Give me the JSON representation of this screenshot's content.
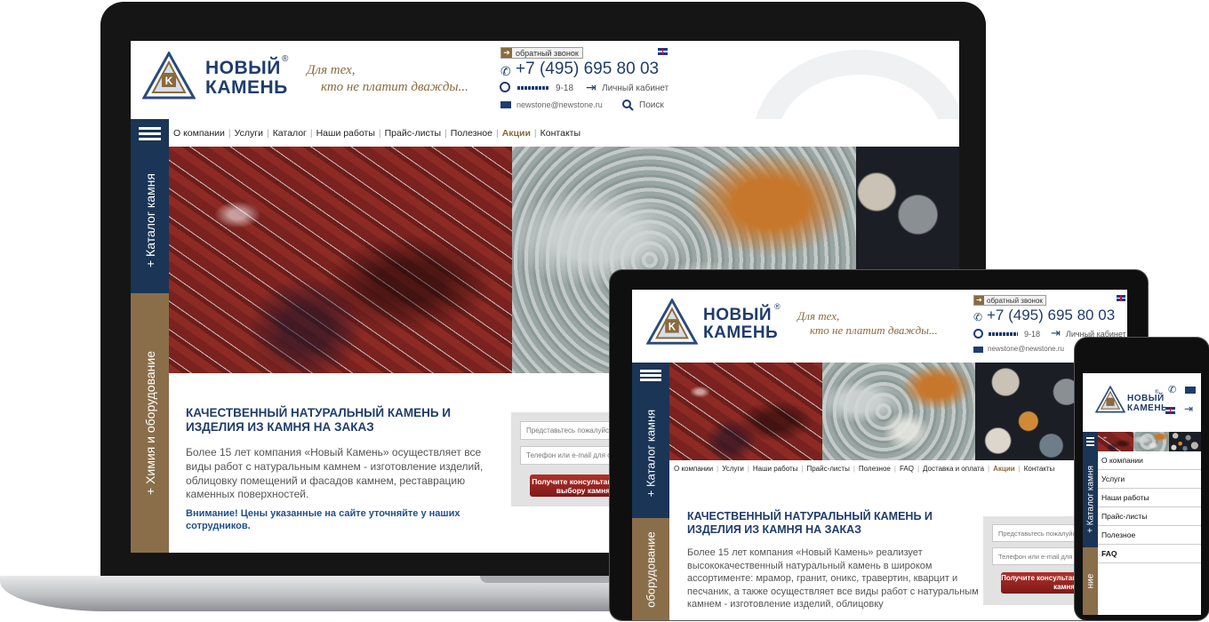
{
  "brand": {
    "name_line1": "НОВЫЙ",
    "name_line2": "КАМЕНЬ",
    "registered": "®",
    "slogan_line1": "Для тех,",
    "slogan_line2": "кто не платит дважды..."
  },
  "header": {
    "callback_label": "обратный звонок",
    "phone": "+7 (495) 695 80 03",
    "hours": "9-18",
    "account_label": "Личный кабинет",
    "email": "newstone@newstone.ru",
    "search_label": "Поиск"
  },
  "nav_desktop": [
    {
      "label": "О компании"
    },
    {
      "label": "Услуги"
    },
    {
      "label": "Каталог"
    },
    {
      "label": "Наши работы"
    },
    {
      "label": "Прайс-листы"
    },
    {
      "label": "Полезное"
    },
    {
      "label": "Акции",
      "highlight": true
    },
    {
      "label": "Контакты"
    }
  ],
  "nav_tablet": [
    {
      "label": "О компании"
    },
    {
      "label": "Услуги"
    },
    {
      "label": "Наши работы"
    },
    {
      "label": "Прайс-листы"
    },
    {
      "label": "Полезное"
    },
    {
      "label": "FAQ"
    },
    {
      "label": "Доставка и оплата"
    },
    {
      "label": "Акции",
      "highlight": true
    },
    {
      "label": "Контакты"
    }
  ],
  "nav_mobile": [
    {
      "label": "О компании"
    },
    {
      "label": "Услуги"
    },
    {
      "label": "Наши работы"
    },
    {
      "label": "Прайс-листы"
    },
    {
      "label": "Полезное"
    },
    {
      "label": "FAQ"
    }
  ],
  "side_tabs": {
    "catalog": "+ Каталог камня",
    "chemistry": "+ Химия и оборудование",
    "chemistry_short_tablet": "оборудование",
    "chemistry_short_mobile": "ние"
  },
  "content": {
    "heading": "КАЧЕСТВЕННЫЙ НАТУРАЛЬНЫЙ КАМЕНЬ И ИЗДЕЛИЯ ИЗ КАМНЯ НА ЗАКАЗ",
    "intro_desktop": "Более 15 лет компания «Новый Камень» осуществляет все виды работ с натуральным камнем - изготовление изделий, облицовку помещений и фасадов камнем, реставрацию каменных поверхностей.",
    "intro_tablet": "Более 15 лет компания «Новый Камень» реализует высококачественный натуральный камень в широком ассортименте: мрамор, гранит, оникс, травертин, кварцит и песчаник, а также осуществляет все виды работ с натуральным камнем - изготовление изделий, облицовку",
    "warning": "Внимание! Цены указанные на сайте уточняйте у наших сотрудников."
  },
  "form": {
    "name_placeholder": "Представьтесь пожалуйста",
    "contact_placeholder": "Телефон или e-mail для связи",
    "submit_label": "Получите консультацию по выбору камня"
  },
  "colors": {
    "navy": "#1b3556",
    "gold": "#8a6a3e",
    "brand_blue": "#1f3c6d",
    "button_red": "#a02a26"
  }
}
